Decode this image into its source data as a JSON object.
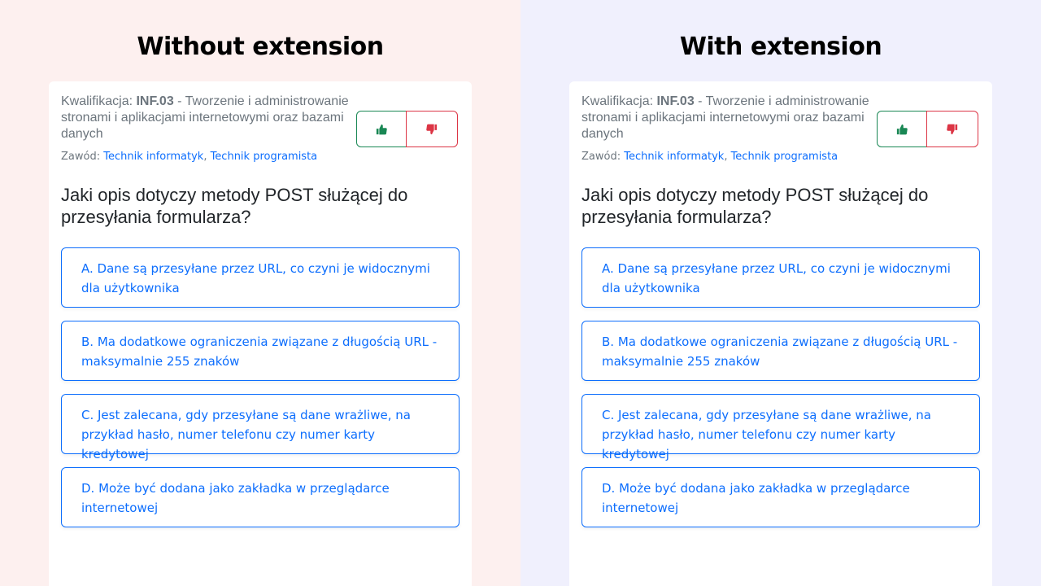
{
  "panels": {
    "left": {
      "title": "Without extension",
      "background": "#fdf0ef",
      "kwal_prefix": "Kwalifikacja: ",
      "kwal_code": "INF.03",
      "kwal_rest": " - Tworzenie i administrowanie stronami i aplikacjami internetowymi oraz bazami danych",
      "zawod_prefix": "Zawód: ",
      "zawod_1": "Technik informatyk",
      "zawod_sep": ", ",
      "zawod_2": "Technik programista",
      "question": "Jaki opis dotyczy metody POST służącej do przesyłania formularza?",
      "answers": [
        "A. Dane są przesyłane przez URL, co czyni je widocznymi dla użytkownika",
        "B. Ma dodatkowe ograniczenia związane z długością URL - maksymalnie 255 znaków",
        "C. Jest zalecana, gdy przesyłane są dane wrażliwe, na przykład hasło, numer telefonu czy numer karty kredytowej",
        "D. Może być dodana jako zakładka w przeglądarce internetowej"
      ]
    },
    "right": {
      "title": "With extension",
      "background": "#f0f0fd",
      "kwal_prefix": "Kwalifikacja: ",
      "kwal_code": "INF.03",
      "kwal_rest": " - Tworzenie i administrowanie stronami i aplikacjami internetowymi oraz bazami danych",
      "zawod_prefix": "Zawód: ",
      "zawod_1": "Technik informatyk",
      "zawod_sep": ", ",
      "zawod_2": "Technik programista",
      "question": "Jaki opis dotyczy metody POST służącej do przesyłania formularza?",
      "answers": [
        "A. Dane są przesyłane przez URL, co czyni je widocznymi dla użytkownika",
        "B. Ma dodatkowe ograniczenia związane z długością URL - maksymalnie 255 znaków",
        "C. Jest zalecana, gdy przesyłane są dane wrażliwe, na przykład hasło, numer telefonu czy numer karty kredytowej",
        "D. Może być dodana jako zakładka w przeglądarce internetowej"
      ]
    }
  },
  "icons": {
    "upvote": "thumbs-up-icon",
    "downvote": "thumbs-down-icon"
  },
  "colors": {
    "primary": "#0d6efd",
    "success": "#198754",
    "danger": "#dc3545",
    "muted": "#6c757d"
  }
}
